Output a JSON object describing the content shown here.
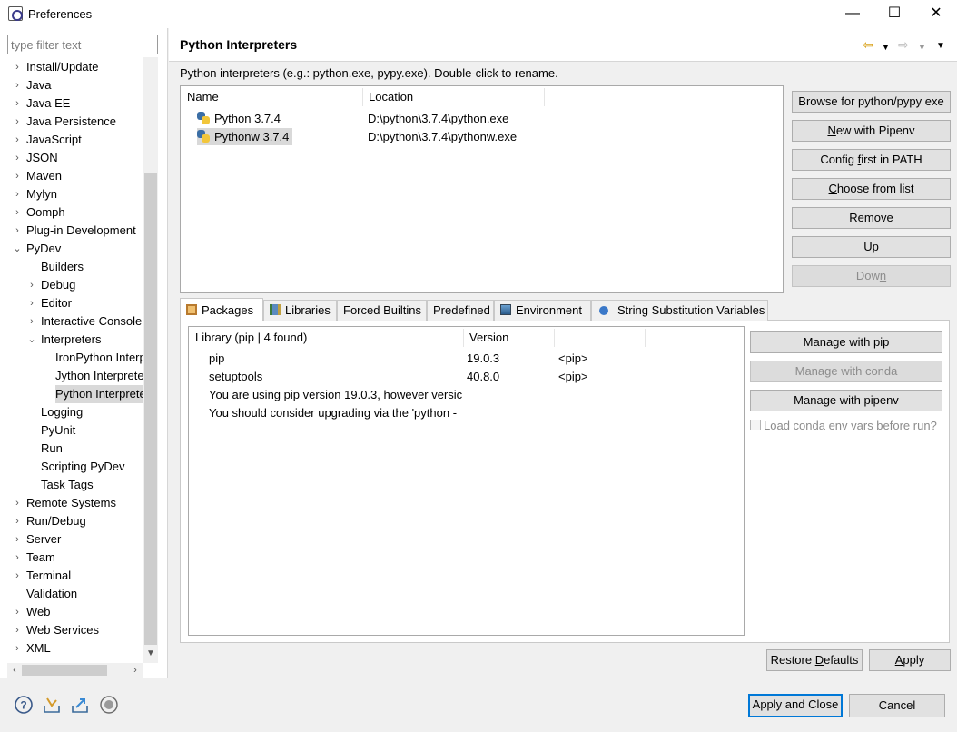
{
  "window": {
    "title": "Preferences",
    "minimize_glyph": "—",
    "maximize_glyph": "☐",
    "close_glyph": "✕"
  },
  "filter": {
    "placeholder": "type filter text"
  },
  "tree": [
    {
      "label": "Install/Update",
      "level": 0,
      "arrow": "›"
    },
    {
      "label": "Java",
      "level": 0,
      "arrow": "›"
    },
    {
      "label": "Java EE",
      "level": 0,
      "arrow": "›"
    },
    {
      "label": "Java Persistence",
      "level": 0,
      "arrow": "›"
    },
    {
      "label": "JavaScript",
      "level": 0,
      "arrow": "›"
    },
    {
      "label": "JSON",
      "level": 0,
      "arrow": "›"
    },
    {
      "label": "Maven",
      "level": 0,
      "arrow": "›"
    },
    {
      "label": "Mylyn",
      "level": 0,
      "arrow": "›"
    },
    {
      "label": "Oomph",
      "level": 0,
      "arrow": "›"
    },
    {
      "label": "Plug-in Development",
      "level": 0,
      "arrow": "›"
    },
    {
      "label": "PyDev",
      "level": 0,
      "arrow": "⌄"
    },
    {
      "label": "Builders",
      "level": 1,
      "arrow": ""
    },
    {
      "label": "Debug",
      "level": 1,
      "arrow": "›"
    },
    {
      "label": "Editor",
      "level": 1,
      "arrow": "›"
    },
    {
      "label": "Interactive Console",
      "level": 1,
      "arrow": "›"
    },
    {
      "label": "Interpreters",
      "level": 1,
      "arrow": "⌄"
    },
    {
      "label": "IronPython Interp",
      "level": 2,
      "arrow": ""
    },
    {
      "label": "Jython Interprete",
      "level": 2,
      "arrow": ""
    },
    {
      "label": "Python Interprete",
      "level": 2,
      "arrow": "",
      "selected": true
    },
    {
      "label": "Logging",
      "level": 1,
      "arrow": ""
    },
    {
      "label": "PyUnit",
      "level": 1,
      "arrow": ""
    },
    {
      "label": "Run",
      "level": 1,
      "arrow": ""
    },
    {
      "label": "Scripting PyDev",
      "level": 1,
      "arrow": ""
    },
    {
      "label": "Task Tags",
      "level": 1,
      "arrow": ""
    },
    {
      "label": "Remote Systems",
      "level": 0,
      "arrow": "›"
    },
    {
      "label": "Run/Debug",
      "level": 0,
      "arrow": "›"
    },
    {
      "label": "Server",
      "level": 0,
      "arrow": "›"
    },
    {
      "label": "Team",
      "level": 0,
      "arrow": "›"
    },
    {
      "label": "Terminal",
      "level": 0,
      "arrow": "›"
    },
    {
      "label": "Validation",
      "level": 0,
      "arrow": ""
    },
    {
      "label": "Web",
      "level": 0,
      "arrow": "›"
    },
    {
      "label": "Web Services",
      "level": 0,
      "arrow": "›"
    },
    {
      "label": "XML",
      "level": 0,
      "arrow": "›"
    }
  ],
  "page": {
    "title": "Python Interpreters",
    "description": "Python interpreters (e.g.: python.exe, pypy.exe).   Double-click to rename."
  },
  "interpreters": {
    "columns": [
      "Name",
      "Location"
    ],
    "rows": [
      {
        "name": "Python 3.7.4",
        "location": "D:\\python\\3.7.4\\python.exe"
      },
      {
        "name": "Pythonw 3.7.4",
        "location": "D:\\python\\3.7.4\\pythonw.exe"
      }
    ]
  },
  "side_buttons": {
    "browse": "Browse for python/pypy exe",
    "pipenv_pre": "",
    "pipenv_key": "N",
    "pipenv_post": "ew with Pipenv",
    "config_pre": "Config ",
    "config_key": "f",
    "config_post": "irst in PATH",
    "choose_pre": "",
    "choose_key": "C",
    "choose_post": "hoose from list",
    "remove_pre": "",
    "remove_key": "R",
    "remove_post": "emove",
    "up_pre": "",
    "up_key": "U",
    "up_post": "p",
    "down_pre": "Dow",
    "down_key": "n",
    "down_post": ""
  },
  "tabs": [
    {
      "label": "Packages",
      "icon": "package-icon"
    },
    {
      "label": "Libraries",
      "icon": "libraries-icon"
    },
    {
      "label": "Forced Builtins",
      "icon": ""
    },
    {
      "label": "Predefined",
      "icon": ""
    },
    {
      "label": "Environment",
      "icon": "environment-icon"
    },
    {
      "label": "String Substitution Variables",
      "icon": "variables-icon"
    }
  ],
  "packages": {
    "columns": [
      "Library (pip | 4 found)",
      "Version",
      ""
    ],
    "rows": [
      {
        "name": "pip",
        "version": "19.0.3",
        "source": "<pip>"
      },
      {
        "name": "setuptools",
        "version": "40.8.0",
        "source": "<pip>"
      },
      {
        "name": "You are using pip version 19.0.3, however versic",
        "version": "",
        "source": ""
      },
      {
        "name": "You should consider upgrading via the 'python -",
        "version": "",
        "source": ""
      }
    ]
  },
  "package_buttons": {
    "pip": "Manage with pip",
    "conda": "Manage with conda",
    "pipenv": "Manage with pipenv",
    "conda_env_label": "Load conda env vars before run?"
  },
  "footer": {
    "restore_pre": "Restore ",
    "restore_key": "D",
    "restore_post": "efaults",
    "apply_pre": "",
    "apply_key": "A",
    "apply_post": "pply",
    "apply_close": "Apply and Close",
    "cancel": "Cancel"
  }
}
